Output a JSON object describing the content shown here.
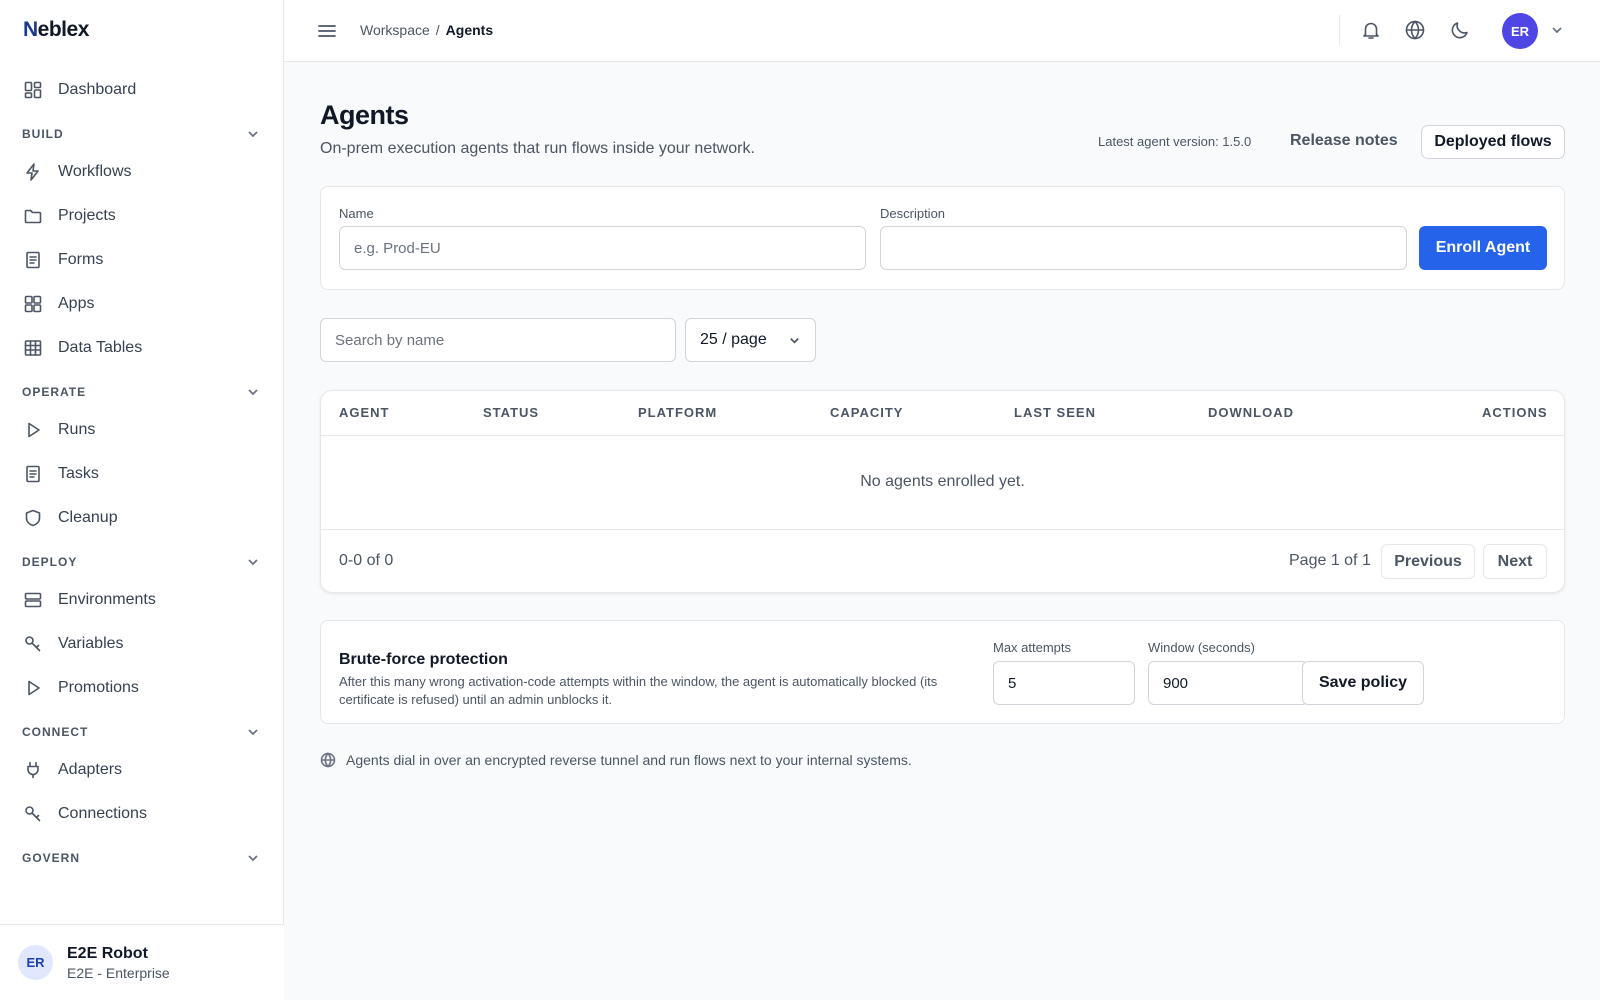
{
  "app": {
    "logo_first": "N",
    "logo_rest": "eblex"
  },
  "sidebar": {
    "dashboard": {
      "label": "Dashboard",
      "icon": "dashboard-icon"
    },
    "sections": [
      {
        "title": "BUILD",
        "items": [
          {
            "label": "Workflows",
            "icon": "lightning-icon"
          },
          {
            "label": "Projects",
            "icon": "folder-icon"
          },
          {
            "label": "Forms",
            "icon": "document-icon"
          },
          {
            "label": "Apps",
            "icon": "grid-icon"
          },
          {
            "label": "Data Tables",
            "icon": "table-icon"
          }
        ]
      },
      {
        "title": "OPERATE",
        "items": [
          {
            "label": "Runs",
            "icon": "play-icon"
          },
          {
            "label": "Tasks",
            "icon": "document-icon"
          },
          {
            "label": "Cleanup",
            "icon": "shield-icon"
          }
        ]
      },
      {
        "title": "DEPLOY",
        "items": [
          {
            "label": "Environments",
            "icon": "server-icon"
          },
          {
            "label": "Variables",
            "icon": "key-icon"
          },
          {
            "label": "Promotions",
            "icon": "play-icon"
          }
        ]
      },
      {
        "title": "CONNECT",
        "items": [
          {
            "label": "Adapters",
            "icon": "plug-icon"
          },
          {
            "label": "Connections",
            "icon": "key-icon"
          }
        ]
      },
      {
        "title": "GOVERN",
        "items": []
      }
    ],
    "user": {
      "initials": "ER",
      "name": "E2E Robot",
      "org": "E2E - Enterprise"
    }
  },
  "topbar": {
    "breadcrumb": [
      "Workspace",
      "Agents"
    ],
    "avatar_initials": "ER"
  },
  "page": {
    "title": "Agents",
    "subtitle": "On-prem execution agents that run flows inside your network.",
    "version_text": "Latest agent version: 1.5.0",
    "release_notes": "Release notes",
    "deployed_flows": "Deployed flows"
  },
  "enroll": {
    "name_label": "Name",
    "name_placeholder": "e.g. Prod-EU",
    "description_label": "Description",
    "description_value": "",
    "button": "Enroll Agent"
  },
  "filters": {
    "search_placeholder": "Search by name",
    "per_page": "25 / page"
  },
  "table": {
    "columns": [
      "AGENT",
      "STATUS",
      "PLATFORM",
      "CAPACITY",
      "LAST SEEN",
      "DOWNLOAD",
      "ACTIONS"
    ],
    "empty": "No agents enrolled yet.",
    "range": "0-0 of 0",
    "page_info": "Page 1 of 1",
    "prev": "Previous",
    "next": "Next"
  },
  "policy": {
    "title": "Brute-force protection",
    "description": "After this many wrong activation-code attempts within the window, the agent is automatically blocked (its certificate is refused) until an admin unblocks it.",
    "max_label": "Max attempts",
    "max_value": "5",
    "window_label": "Window (seconds)",
    "window_value": "900",
    "save": "Save policy"
  },
  "note": "Agents dial in over an encrypted reverse tunnel and run flows next to your internal systems.",
  "colors": {
    "primary": "#2563eb",
    "avatar": "#4f46e5"
  }
}
